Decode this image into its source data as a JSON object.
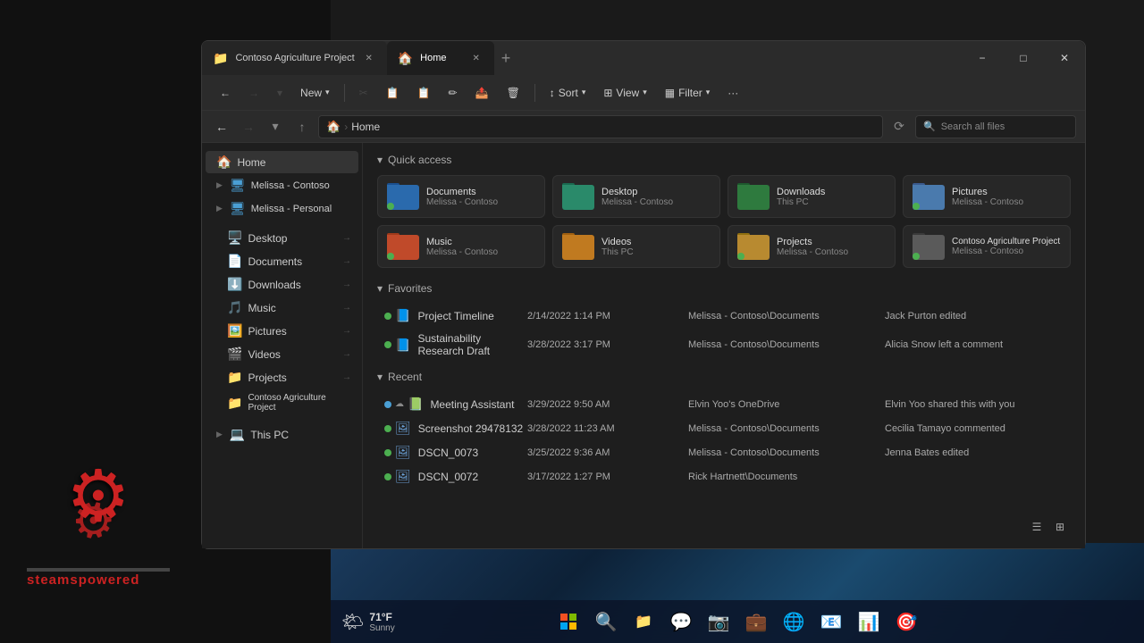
{
  "window": {
    "tabs": [
      {
        "id": "tab1",
        "label": "Contoso Agriculture Project",
        "icon": "📁",
        "active": false
      },
      {
        "id": "tab2",
        "label": "Home",
        "icon": "🏠",
        "active": true
      }
    ],
    "add_tab": "+",
    "min": "−",
    "max": "□",
    "close": "✕"
  },
  "toolbar": {
    "new_label": "New",
    "sort_label": "Sort",
    "view_label": "View",
    "filter_label": "Filter",
    "more_label": "···"
  },
  "address_bar": {
    "home_label": "Home",
    "search_placeholder": "Search all files"
  },
  "sidebar": {
    "home": "Home",
    "melissa_contoso": "Melissa - Contoso",
    "melissa_personal": "Melissa - Personal",
    "items": [
      {
        "label": "Desktop",
        "icon": "🖥️",
        "color": "blue"
      },
      {
        "label": "Documents",
        "icon": "📄",
        "color": "blue"
      },
      {
        "label": "Downloads",
        "icon": "⬇️",
        "color": "green"
      },
      {
        "label": "Music",
        "icon": "🎵",
        "color": "orange"
      },
      {
        "label": "Pictures",
        "icon": "🖼️",
        "color": "blue"
      },
      {
        "label": "Videos",
        "icon": "🎬",
        "color": "blue"
      },
      {
        "label": "Projects",
        "icon": "📁",
        "color": "yellow"
      },
      {
        "label": "Contoso Agriculture Project",
        "icon": "📁",
        "color": "yellow"
      }
    ],
    "this_pc": "This PC"
  },
  "quick_access": {
    "section_label": "Quick access",
    "items": [
      {
        "name": "Documents",
        "sub": "Melissa - Contoso",
        "color": "blue",
        "has_dot": true
      },
      {
        "name": "Desktop",
        "sub": "Melissa - Contoso",
        "color": "teal",
        "has_dot": false
      },
      {
        "name": "Downloads",
        "sub": "This PC",
        "color": "green",
        "has_dot": false
      },
      {
        "name": "Pictures",
        "sub": "Melissa - Contoso",
        "color": "grey",
        "has_dot": true
      },
      {
        "name": "Music",
        "sub": "Melissa - Contoso",
        "color": "red",
        "has_dot": true
      },
      {
        "name": "Videos",
        "sub": "This PC",
        "color": "orange2",
        "has_dot": false
      },
      {
        "name": "Projects",
        "sub": "Melissa - Contoso",
        "color": "yellow",
        "has_dot": true
      },
      {
        "name": "Contoso Agriculture Project",
        "sub": "Melissa - Contoso",
        "color": "dark",
        "has_dot": true
      }
    ]
  },
  "favorites": {
    "section_label": "Favorites",
    "rows": [
      {
        "name": "Project Timeline",
        "date": "2/14/2022 1:14 PM",
        "location": "Melissa - Contoso\\Documents",
        "activity": "Jack Purton edited",
        "type": "doc"
      },
      {
        "name": "Sustainability Research Draft",
        "date": "3/28/2022 3:17 PM",
        "location": "Melissa - Contoso\\Documents",
        "activity": "Alicia Snow left a comment",
        "type": "doc"
      }
    ]
  },
  "recent": {
    "section_label": "Recent",
    "rows": [
      {
        "name": "Meeting Assistant",
        "date": "3/29/2022 9:50 AM",
        "location": "Elvin Yoo's OneDrive",
        "activity": "Elvin Yoo shared this with you",
        "type": "xls",
        "cloud": true
      },
      {
        "name": "Screenshot 29478132",
        "date": "3/28/2022 11:23 AM",
        "location": "Melissa - Contoso\\Documents",
        "activity": "Cecilia Tamayo commented",
        "type": "img"
      },
      {
        "name": "DSCN_0073",
        "date": "3/25/2022 9:36 AM",
        "location": "Melissa - Contoso\\Documents",
        "activity": "Jenna Bates edited",
        "type": "img"
      },
      {
        "name": "DSCN_0072",
        "date": "3/17/2022 1:27 PM",
        "location": "Rick Hartnett\\Documents",
        "activity": "",
        "type": "img"
      }
    ]
  },
  "taskbar": {
    "weather_temp": "71°F",
    "weather_desc": "Sunny",
    "icons": [
      "⊞",
      "🔍",
      "📁",
      "💬",
      "📷",
      "💼",
      "🌐",
      "📧",
      "📊",
      "🎯"
    ]
  }
}
